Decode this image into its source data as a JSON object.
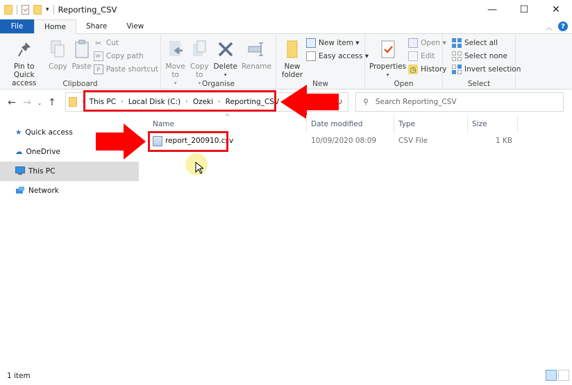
{
  "window": {
    "title": "Reporting_CSV",
    "minimize": "—",
    "maximize": "☐",
    "close": "✕"
  },
  "tabs": [
    {
      "label": "File"
    },
    {
      "label": "Home"
    },
    {
      "label": "Share"
    },
    {
      "label": "View"
    }
  ],
  "ribbon": {
    "clipboard": {
      "label": "Clipboard",
      "pin": "Pin to Quick access",
      "copy": "Copy",
      "paste": "Paste",
      "cut": "Cut",
      "copy_path": "Copy path",
      "paste_shortcut": "Paste shortcut"
    },
    "organise": {
      "label": "Organise",
      "move_to": "Move to",
      "copy_to": "Copy to",
      "delete": "Delete",
      "rename": "Rename"
    },
    "new": {
      "label": "New",
      "new_folder": "New folder",
      "new_item": "New item ▾",
      "easy_access": "Easy access ▾"
    },
    "open": {
      "label": "Open",
      "properties": "Properties",
      "open": "Open ▾",
      "edit": "Edit",
      "history": "History"
    },
    "select": {
      "label": "Select",
      "select_all": "Select all",
      "select_none": "Select none",
      "invert": "Invert selection"
    }
  },
  "address": {
    "crumbs": [
      "This PC",
      "Local Disk (C:)",
      "Ozeki",
      "Reporting_CSV"
    ]
  },
  "search": {
    "placeholder": "Search Reporting_CSV"
  },
  "sidebar": {
    "items": [
      {
        "label": "Quick access",
        "icon": "star-icon"
      },
      {
        "label": "OneDrive",
        "icon": "cloud-icon"
      },
      {
        "label": "This PC",
        "icon": "computer-icon",
        "selected": true
      },
      {
        "label": "Network",
        "icon": "network-icon"
      }
    ]
  },
  "columns": {
    "name": "Name",
    "date": "Date modified",
    "type": "Type",
    "size": "Size"
  },
  "files": [
    {
      "name": "report_200910.csv",
      "date": "10/09/2020 08:09",
      "type": "CSV File",
      "size": "1 KB"
    }
  ],
  "status": {
    "count": "1 item"
  },
  "annotation_color": "#e8121b"
}
